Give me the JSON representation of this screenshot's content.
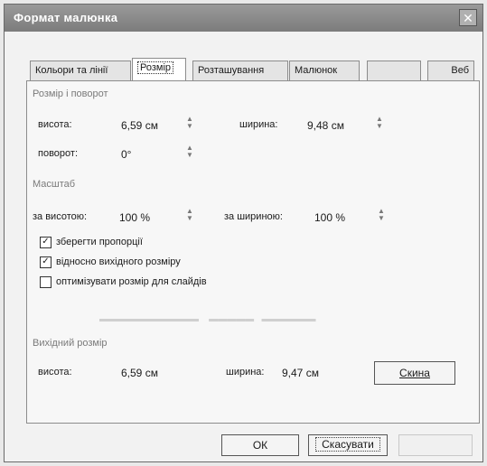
{
  "window": {
    "title": "Формат малюнка"
  },
  "tabs": [
    {
      "label": "Кольори та лінії"
    },
    {
      "label": "Розмір"
    },
    {
      "label": "Розташування"
    },
    {
      "label": "Малюнок"
    },
    {
      "label": ""
    },
    {
      "label": "Веб"
    }
  ],
  "size_rotate": {
    "heading": "Розмір і поворот",
    "height_label": "висота:",
    "height_value": "6,59 см",
    "width_label": "ширина:",
    "width_value": "9,48 см",
    "rotation_label": "поворот:",
    "rotation_value": "0°"
  },
  "scale": {
    "heading": "Масштаб",
    "height_label": "за висотою:",
    "height_value": "100 %",
    "width_label": "за шириною:",
    "width_value": "100 %",
    "lock_aspect": {
      "label": "зберегти пропорції",
      "checked": true
    },
    "relative_original": {
      "label": "відносно вихідного розміру",
      "checked": true
    },
    "optimize_slides": {
      "label": "оптимізувати розмір для слайдів",
      "checked": false
    }
  },
  "original": {
    "heading": "Вихідний розмір",
    "height_label": "висота:",
    "height_value": "6,59 см",
    "width_label": "ширина:",
    "width_value": "9,47 см",
    "reset_label": "Скина"
  },
  "footer": {
    "ok_label": "ОК",
    "cancel_label": "Скасувати"
  }
}
